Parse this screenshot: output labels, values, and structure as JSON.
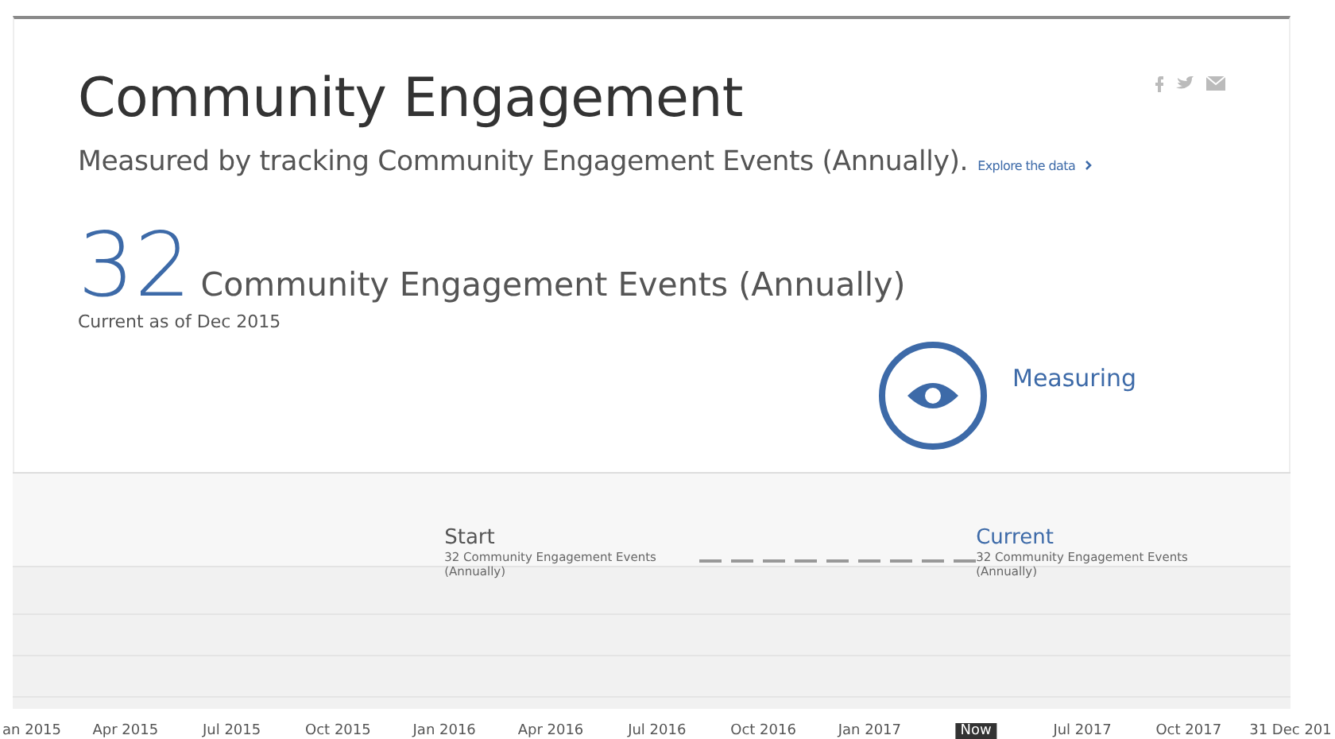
{
  "title": "Community Engagement",
  "subtitle": "Measured by tracking Community Engagement Events (Annually).",
  "explore_link": "Explore the data",
  "metric": {
    "value": "32",
    "unit": "Community Engagement Events (Annually)",
    "as_of": "Current as of Dec 2015"
  },
  "status": {
    "kind": "measuring",
    "label": "Measuring"
  },
  "timeline": {
    "markers": [
      {
        "kind": "start",
        "title": "Start",
        "detail": "32 Community Engagement Events",
        "detail_break": "(Annually)"
      },
      {
        "kind": "current",
        "title": "Current",
        "detail": "32 Community Engagement Events",
        "detail_break": "(Annually)"
      }
    ],
    "axis_labels": [
      {
        "label": "an 2015",
        "kind": "date"
      },
      {
        "label": "Apr 2015",
        "kind": "date"
      },
      {
        "label": "Jul 2015",
        "kind": "date"
      },
      {
        "label": "Oct 2015",
        "kind": "date"
      },
      {
        "label": "Jan 2016",
        "kind": "date"
      },
      {
        "label": "Apr 2016",
        "kind": "date"
      },
      {
        "label": "Jul 2016",
        "kind": "date"
      },
      {
        "label": "Oct 2016",
        "kind": "date"
      },
      {
        "label": "Jan 2017",
        "kind": "date"
      },
      {
        "label": "Now",
        "kind": "now"
      },
      {
        "label": "Jul 2017",
        "kind": "date"
      },
      {
        "label": "Oct 2017",
        "kind": "date"
      },
      {
        "label": "31 Dec 201",
        "kind": "date"
      }
    ]
  }
}
